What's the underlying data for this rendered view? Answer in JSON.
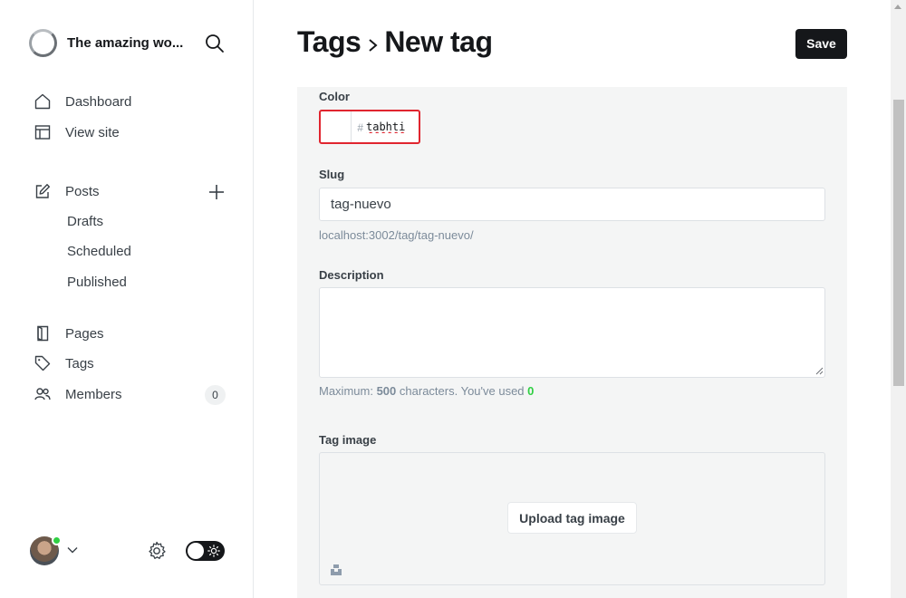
{
  "sidebar": {
    "brand_title": "The amazing wo...",
    "nav": {
      "dashboard": "Dashboard",
      "view_site": "View site",
      "posts": "Posts",
      "drafts": "Drafts",
      "scheduled": "Scheduled",
      "published": "Published",
      "pages": "Pages",
      "tags": "Tags",
      "members": "Members",
      "members_count": "0"
    },
    "icons": [
      "search-icon",
      "home-icon",
      "layout-icon",
      "edit-icon",
      "plus-icon",
      "page-icon",
      "tag-icon",
      "members-icon",
      "gear-icon",
      "sun-icon",
      "chevron-down-icon"
    ],
    "online_color": "#30cf43"
  },
  "header": {
    "breadcrumb_parent": "Tags",
    "breadcrumb_current": "New tag",
    "save_label": "Save"
  },
  "form": {
    "color_label": "Color",
    "color_hash": "#",
    "color_value": "tabhti",
    "color_error_border": "#e0252f",
    "slug_label": "Slug",
    "slug_value": "tag-nuevo",
    "slug_url": "localhost:3002/tag/tag-nuevo/",
    "description_label": "Description",
    "description_value": "",
    "desc_hint_prefix": "Maximum:",
    "desc_hint_max": "500",
    "desc_hint_mid": "characters. You've used",
    "desc_hint_used": "0",
    "tag_image_label": "Tag image",
    "upload_label": "Upload tag image"
  }
}
